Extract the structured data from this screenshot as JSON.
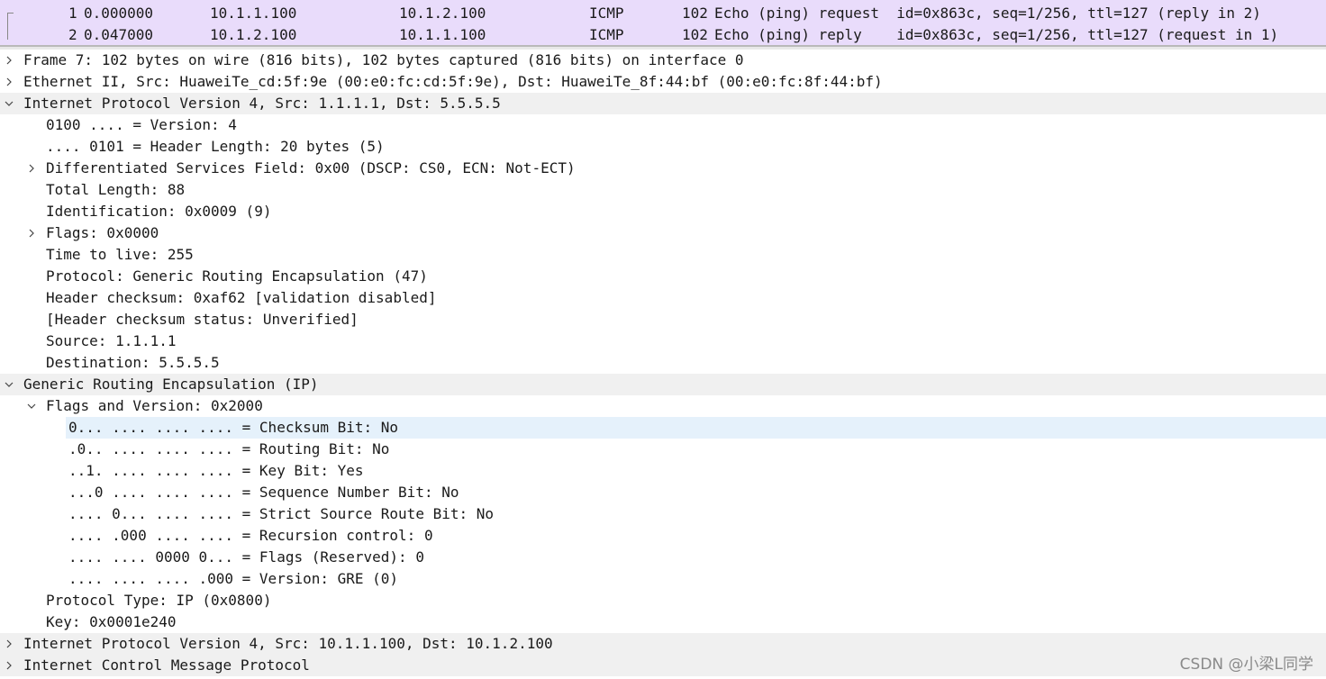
{
  "packet_list": {
    "rows": [
      {
        "no": "1",
        "time": "0.000000",
        "source": "10.1.1.100",
        "destination": "10.1.2.100",
        "protocol": "ICMP",
        "length": "102",
        "info": "Echo (ping) request  id=0x863c, seq=1/256, ttl=127 (reply in 2)"
      },
      {
        "no": "2",
        "time": "0.047000",
        "source": "10.1.2.100",
        "destination": "10.1.1.100",
        "protocol": "ICMP",
        "length": "102",
        "info": "Echo (ping) reply    id=0x863c, seq=1/256, ttl=127 (request in 1)"
      }
    ]
  },
  "details": {
    "frame": "Frame 7: 102 bytes on wire (816 bits), 102 bytes captured (816 bits) on interface 0",
    "ethernet": "Ethernet II, Src: HuaweiTe_cd:5f:9e (00:e0:fc:cd:5f:9e), Dst: HuaweiTe_8f:44:bf (00:e0:fc:8f:44:bf)",
    "ip_outer": {
      "header": "Internet Protocol Version 4, Src: 1.1.1.1, Dst: 5.5.5.5",
      "version": "0100 .... = Version: 4",
      "header_length": ".... 0101 = Header Length: 20 bytes (5)",
      "dsfield": "Differentiated Services Field: 0x00 (DSCP: CS0, ECN: Not-ECT)",
      "total_length": "Total Length: 88",
      "identification": "Identification: 0x0009 (9)",
      "flags": "Flags: 0x0000",
      "ttl": "Time to live: 255",
      "protocol": "Protocol: Generic Routing Encapsulation (47)",
      "checksum": "Header checksum: 0xaf62 [validation disabled]",
      "checksum_status": "[Header checksum status: Unverified]",
      "source": "Source: 1.1.1.1",
      "destination": "Destination: 5.5.5.5"
    },
    "gre": {
      "header": "Generic Routing Encapsulation (IP)",
      "flags_version": "Flags and Version: 0x2000",
      "bits": {
        "checksum": "0... .... .... .... = Checksum Bit: No",
        "routing": ".0.. .... .... .... = Routing Bit: No",
        "key": "..1. .... .... .... = Key Bit: Yes",
        "sequence": "...0 .... .... .... = Sequence Number Bit: No",
        "strict_source": ".... 0... .... .... = Strict Source Route Bit: No",
        "recursion": ".... .000 .... .... = Recursion control: 0",
        "flags_reserved": ".... .... 0000 0... = Flags (Reserved): 0",
        "version": ".... .... .... .000 = Version: GRE (0)"
      },
      "protocol_type": "Protocol Type: IP (0x0800)",
      "key": "Key: 0x0001e240"
    },
    "ip_inner": "Internet Protocol Version 4, Src: 10.1.1.100, Dst: 10.1.2.100",
    "icmp": "Internet Control Message Protocol"
  },
  "watermark": "CSDN @小梁L同学",
  "colors": {
    "packet_row_bg": "#e9dcfb",
    "header_row_bg": "#f0f0f0",
    "selected_bg": "#e5f1fb"
  }
}
